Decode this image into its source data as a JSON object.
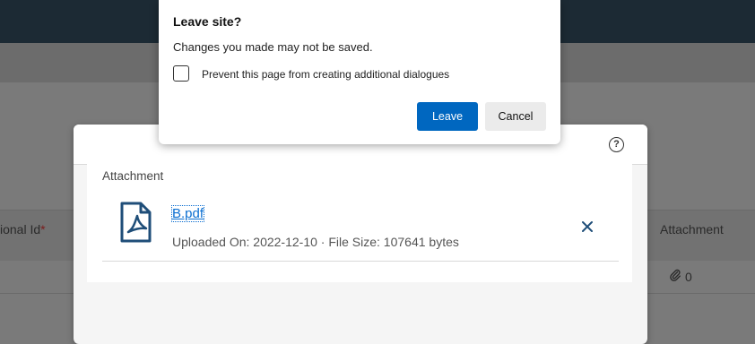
{
  "background": {
    "column_national_id": "ional Id",
    "required_marker": "*",
    "column_attachment": "Attachment",
    "row_attachment_count": "0"
  },
  "attachment_dialog": {
    "section_title": "Attachment",
    "file": {
      "name": "B.pdf",
      "meta": "Uploaded On: 2022-12-10 · File Size: 107641 bytes"
    },
    "help_icon": "?"
  },
  "leave_dialog": {
    "title": "Leave site?",
    "message": "Changes you made may not be saved.",
    "checkbox_label": "Prevent this page from creating additional dialogues",
    "checkbox_checked": false,
    "leave_label": "Leave",
    "cancel_label": "Cancel"
  },
  "colors": {
    "primary": "#0067c0",
    "link": "#0a6ed1",
    "header": "#1c2a34"
  }
}
